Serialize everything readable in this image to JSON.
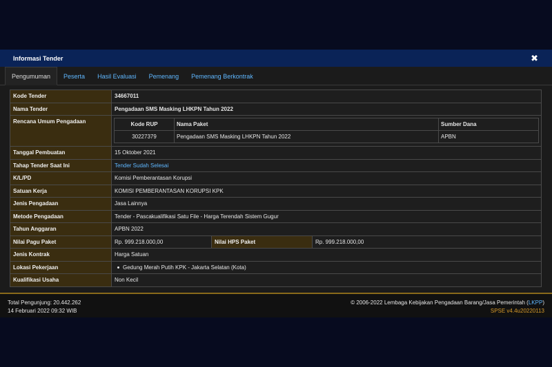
{
  "modal": {
    "title": "Informasi Tender",
    "close_symbol": "✖"
  },
  "tabs": [
    {
      "label": "Pengumuman",
      "active": true
    },
    {
      "label": "Peserta"
    },
    {
      "label": "Hasil Evaluasi"
    },
    {
      "label": "Pemenang"
    },
    {
      "label": "Pemenang Berkontrak"
    }
  ],
  "info": {
    "kode_tender": {
      "label": "Kode Tender",
      "value": "34667011"
    },
    "nama_tender": {
      "label": "Nama Tender",
      "value": "Pengadaan SMS Masking LHKPN Tahun 2022"
    },
    "rup": {
      "label": "Rencana Umum Pengadaan",
      "headers": [
        "Kode RUP",
        "Nama Paket",
        "Sumber Dana"
      ],
      "rows": [
        [
          "30227379",
          "Pengadaan SMS Masking LHKPN Tahun 2022",
          "APBN"
        ]
      ]
    },
    "tanggal": {
      "label": "Tanggal Pembuatan",
      "value": "15 Oktober 2021"
    },
    "tahap": {
      "label": "Tahap Tender Saat Ini",
      "value": "Tender Sudah Selesai"
    },
    "klpd": {
      "label": "K/L/PD",
      "value": "Komisi Pemberantasan Korupsi"
    },
    "satuan": {
      "label": "Satuan Kerja",
      "value": "KOMISI PEMBERANTASAN KORUPSI KPK"
    },
    "jenis_pengadaan": {
      "label": "Jenis Pengadaan",
      "value": "Jasa Lainnya"
    },
    "metode": {
      "label": "Metode Pengadaan",
      "value": "Tender - Pascakualifikasi Satu File - Harga Terendah Sistem Gugur"
    },
    "tahun": {
      "label": "Tahun Anggaran",
      "value": "APBN 2022"
    },
    "pagu": {
      "label": "Nilai Pagu Paket",
      "value": "Rp. 999.218.000,00",
      "hps_label": "Nilai HPS Paket",
      "hps_value": "Rp. 999.218.000,00"
    },
    "kontrak": {
      "label": "Jenis Kontrak",
      "value": "Harga Satuan"
    },
    "lokasi": {
      "label": "Lokasi Pekerjaan",
      "value": "Gedung Merah Putih KPK - Jakarta Selatan (Kota)"
    },
    "kualifikasi": {
      "label": "Kualifikasi Usaha",
      "value": "Non Kecil"
    }
  },
  "footer": {
    "visitors": "Total Pengunjung: 20.442.262",
    "datetime": "14 Februari 2022 09:32 WIB",
    "copyright_prefix": "© 2006-2022 Lembaga Kebijakan Pengadaan Barang/Jasa Pemerintah (",
    "lkpp": "LKPP",
    "copyright_suffix": ")",
    "version": "SPSE v4.4u20220113"
  },
  "colors": {
    "titlebar": "#0a2357",
    "label_bg": "#3a2d10",
    "link": "#5fb7ff",
    "version": "#d79a2a"
  }
}
